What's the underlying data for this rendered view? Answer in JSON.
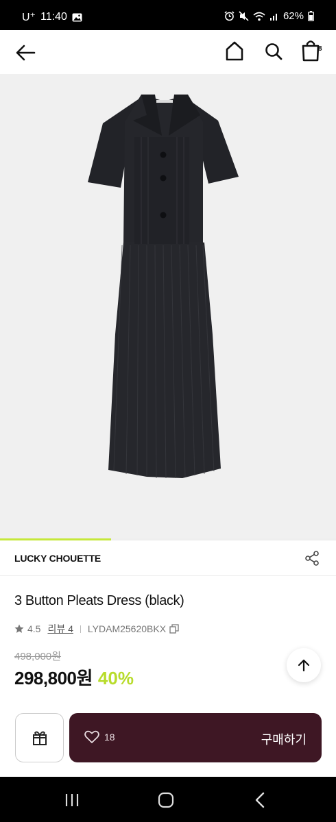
{
  "status_bar": {
    "carrier": "U⁺",
    "time": "11:40",
    "battery": "62%"
  },
  "header": {
    "cart_count": "8"
  },
  "product": {
    "image_alt": "3 Button Pleats Dress (black)",
    "image_progress": 0.33,
    "brand": "LUCKY CHOUETTE",
    "title": "3 Button Pleats Dress (black)",
    "rating": "4.5",
    "review_label": "리뷰 4",
    "code": "LYDAM25620BKX",
    "original_price": "498,000원",
    "sale_price": "298,800원",
    "discount": "40%"
  },
  "actions": {
    "like_count": "18",
    "buy_label": "구매하기"
  },
  "colors": {
    "accent": "#c6e83a",
    "buy_bar": "#3e1724",
    "discount": "#b8dc2c"
  }
}
